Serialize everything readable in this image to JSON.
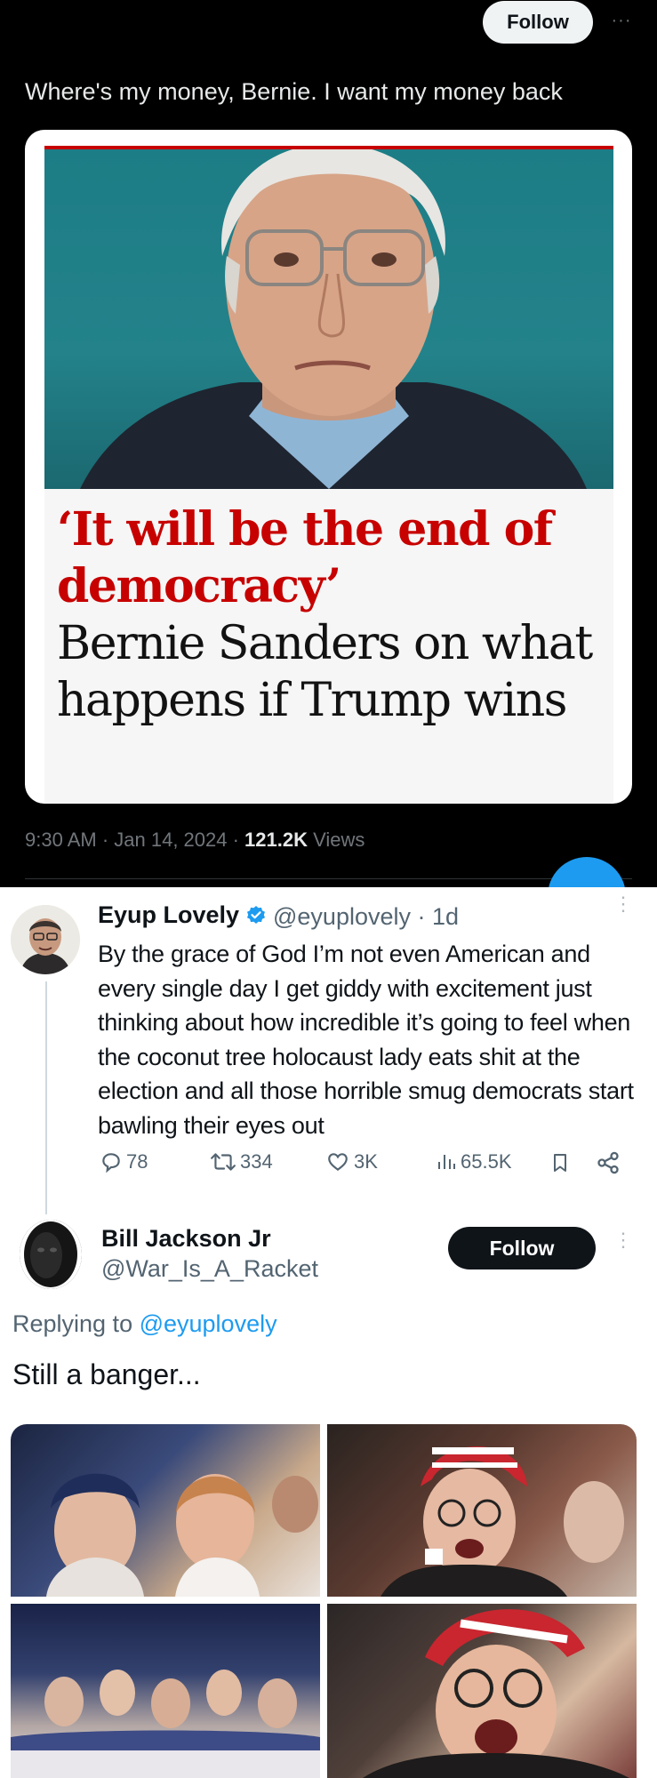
{
  "header": {
    "follow_label": "Follow",
    "more_label": "···"
  },
  "tweet": {
    "text": "Where's my money, Bernie.  I want my money back",
    "card": {
      "headline_red": "‘It will be the end of democracy’",
      "headline_black": "Bernie Sanders on what happens if Trump wins",
      "red_accent": "#c70000"
    },
    "timestamp": "9:30 AM · Jan 14, 2024 · ",
    "views_count": "121.2K",
    "views_label": " Views"
  },
  "reply1": {
    "name": "Eyup Lovely",
    "handle": "@eyuplovely · 1d",
    "text": "By the grace of God I’m not even American and every single day I get giddy with excitement just thinking about how incredible it’s going to feel when the coconut tree holocaust lady eats shit at the election and all those horrible smug democrats start bawling their eyes out",
    "stats": {
      "replies": "78",
      "reposts": "334",
      "likes": "3K",
      "views": "65.5K"
    },
    "icons": [
      "reply-icon",
      "repost-icon",
      "like-icon",
      "views-icon",
      "bookmark-icon",
      "share-icon"
    ]
  },
  "reply2": {
    "name": "Bill Jackson Jr",
    "handle": "@War_Is_A_Racket",
    "follow_label": "Follow",
    "replying_prefix": "Replying to ",
    "replying_handle": "@eyuplovely",
    "text": "Still a banger..."
  },
  "colors": {
    "accent": "#1d9bf0",
    "dark_bg": "#000000",
    "light_bg": "#ffffff"
  }
}
